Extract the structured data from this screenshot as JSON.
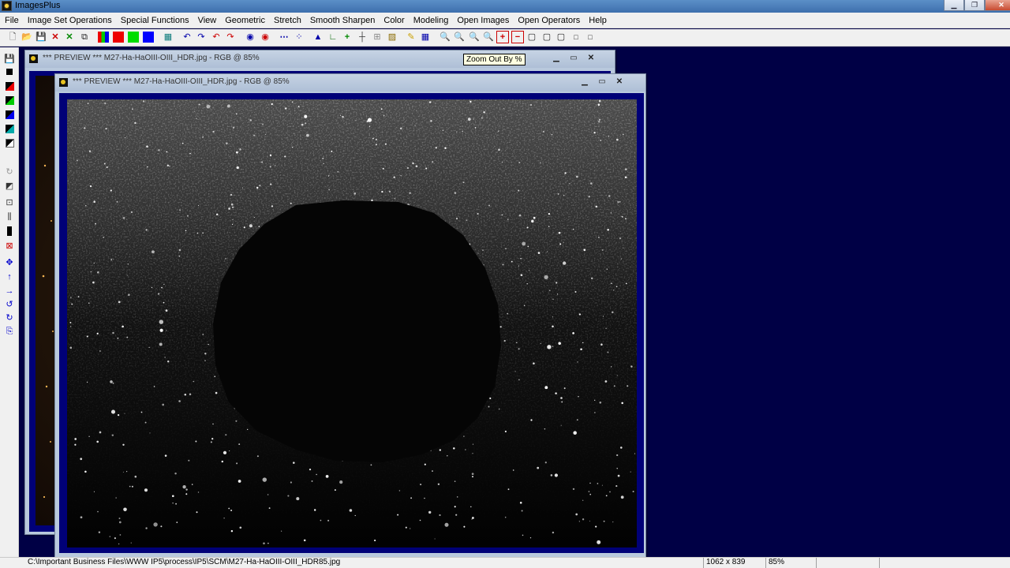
{
  "app": {
    "title": "ImagesPlus"
  },
  "menu": [
    "File",
    "Image Set Operations",
    "Special Functions",
    "View",
    "Geometric",
    "Stretch",
    "Smooth Sharpen",
    "Color",
    "Modeling",
    "Open Images",
    "Open Operators",
    "Help"
  ],
  "tooltip": "Zoom Out By %",
  "windows": {
    "back": {
      "title": "*** PREVIEW *** M27-Ha-HaOIII-OIII_HDR.jpg - RGB @ 85%"
    },
    "front": {
      "title": "*** PREVIEW *** M27-Ha-HaOIII-OIII_HDR.jpg - RGB @ 85%"
    }
  },
  "status": {
    "path": "C:\\Important Business Files\\WWW IP5\\process\\IP5\\SCM\\M27-Ha-HaOIII-OIII_HDR85.jpg",
    "dimensions": "1062 x 839",
    "zoom": "85%"
  }
}
